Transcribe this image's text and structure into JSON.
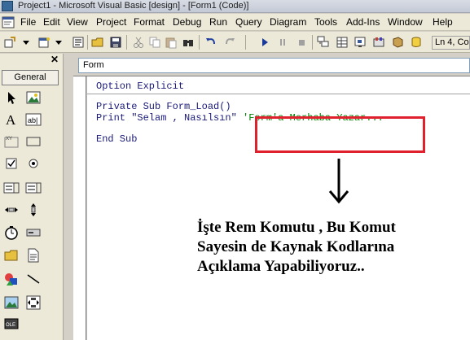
{
  "window": {
    "title": "Project1 - Microsoft Visual Basic [design] - [Form1 (Code)]"
  },
  "menu": [
    {
      "label": "File",
      "name": "menu-file"
    },
    {
      "label": "Edit",
      "name": "menu-edit"
    },
    {
      "label": "View",
      "name": "menu-view"
    },
    {
      "label": "Project",
      "name": "menu-project"
    },
    {
      "label": "Format",
      "name": "menu-format"
    },
    {
      "label": "Debug",
      "name": "menu-debug"
    },
    {
      "label": "Run",
      "name": "menu-run"
    },
    {
      "label": "Query",
      "name": "menu-query"
    },
    {
      "label": "Diagram",
      "name": "menu-diagram"
    },
    {
      "label": "Tools",
      "name": "menu-tools"
    },
    {
      "label": "Add-Ins",
      "name": "menu-add-ins"
    },
    {
      "label": "Window",
      "name": "menu-window"
    },
    {
      "label": "Help",
      "name": "menu-help"
    }
  ],
  "toolbar": {
    "position_text": "Ln 4, Co"
  },
  "toolbox": {
    "close_glyph": "✕",
    "tab_label": "General"
  },
  "code_window": {
    "object_combo": "Form",
    "line_option": "Option Explicit",
    "line_sub": "Private Sub Form_Load()",
    "line_print": "Print \"Selam , Nasılsın\" ",
    "line_comment": "'Form'a Merhaba Yazar...",
    "line_end": "End Sub"
  },
  "annotation": {
    "line1": "İşte Rem Komutu , Bu Komut",
    "line2": "Sayesin de Kaynak Kodlarına",
    "line3": "Açıklama Yapabiliyoruz.."
  },
  "colors": {
    "highlight": "#e0202c",
    "comment": "#008000",
    "keyword": "#1a1a7a"
  }
}
